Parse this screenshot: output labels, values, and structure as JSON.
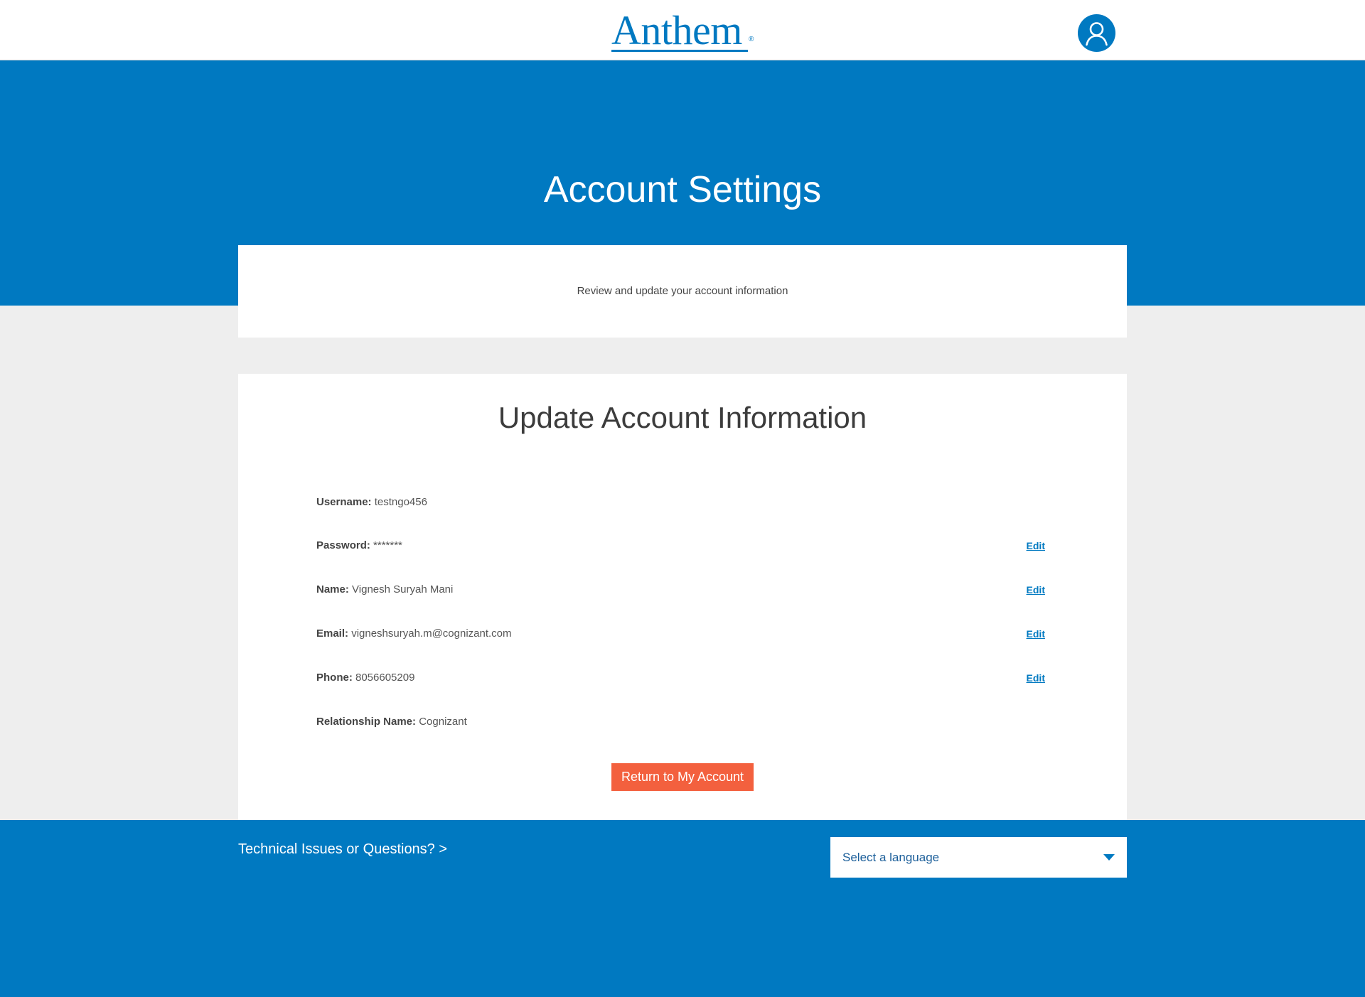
{
  "header": {
    "logo_text": "Anthem",
    "logo_mark": "®"
  },
  "hero": {
    "title": "Account Settings"
  },
  "intro": {
    "text": "Review and update your account information"
  },
  "account": {
    "title": "Update Account Information",
    "fields": [
      {
        "label": "Username:",
        "value": "testngo456",
        "edit": ""
      },
      {
        "label": "Password:",
        "value": "*******",
        "edit": "Edit"
      },
      {
        "label": "Name:",
        "value": "Vignesh Suryah Mani",
        "edit": "Edit"
      },
      {
        "label": "Email:",
        "value": "vigneshsuryah.m@cognizant.com",
        "edit": "Edit"
      },
      {
        "label": "Phone:",
        "value": "8056605209",
        "edit": "Edit"
      },
      {
        "label": "Relationship Name:",
        "value": "Cognizant",
        "edit": ""
      }
    ],
    "return_button": "Return to My Account"
  },
  "footer": {
    "help_link": "Technical Issues or Questions? >",
    "language_select": "Select a language"
  },
  "icons": {
    "avatar": "user-icon",
    "dropdown": "caret-down-icon"
  },
  "colors": {
    "brand_blue": "#0079c1",
    "button_orange": "#f3603e",
    "page_bg": "#eeeeee"
  }
}
